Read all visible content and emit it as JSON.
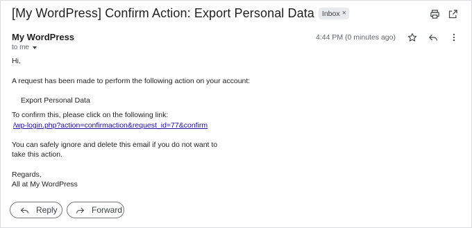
{
  "email": {
    "subject": "[My WordPress] Confirm Action: Export Personal Data",
    "label_chip": "Inbox",
    "sender_name": "My WordPress",
    "recipient_line": "to me",
    "timestamp": "4:44 PM (0 minutes ago)",
    "body": {
      "greeting": "Hi,",
      "intro": "A request has been made to perform the following action on your account:",
      "action_name": "Export Personal Data",
      "confirm_prompt": "To confirm this, please click on the following link:",
      "confirm_link": "/wp-login.php?action=confirmaction&request_id=77&confirm",
      "ignore_line_1": "You can safely ignore and delete this email if you do not want to",
      "ignore_line_2": "take this action.",
      "regards": "Regards,",
      "signature": "All at My WordPress"
    }
  },
  "actions": {
    "reply_label": "Reply",
    "forward_label": "Forward"
  },
  "icons": {
    "print": "print-icon",
    "open_new_window": "open-in-new-window-icon",
    "star": "star-icon",
    "reply": "reply-icon",
    "more": "more-vertical-icon",
    "forward": "forward-icon"
  },
  "colors": {
    "link": "#1a0dab",
    "chip_background": "#e8eaed",
    "border": "#dadce0"
  }
}
